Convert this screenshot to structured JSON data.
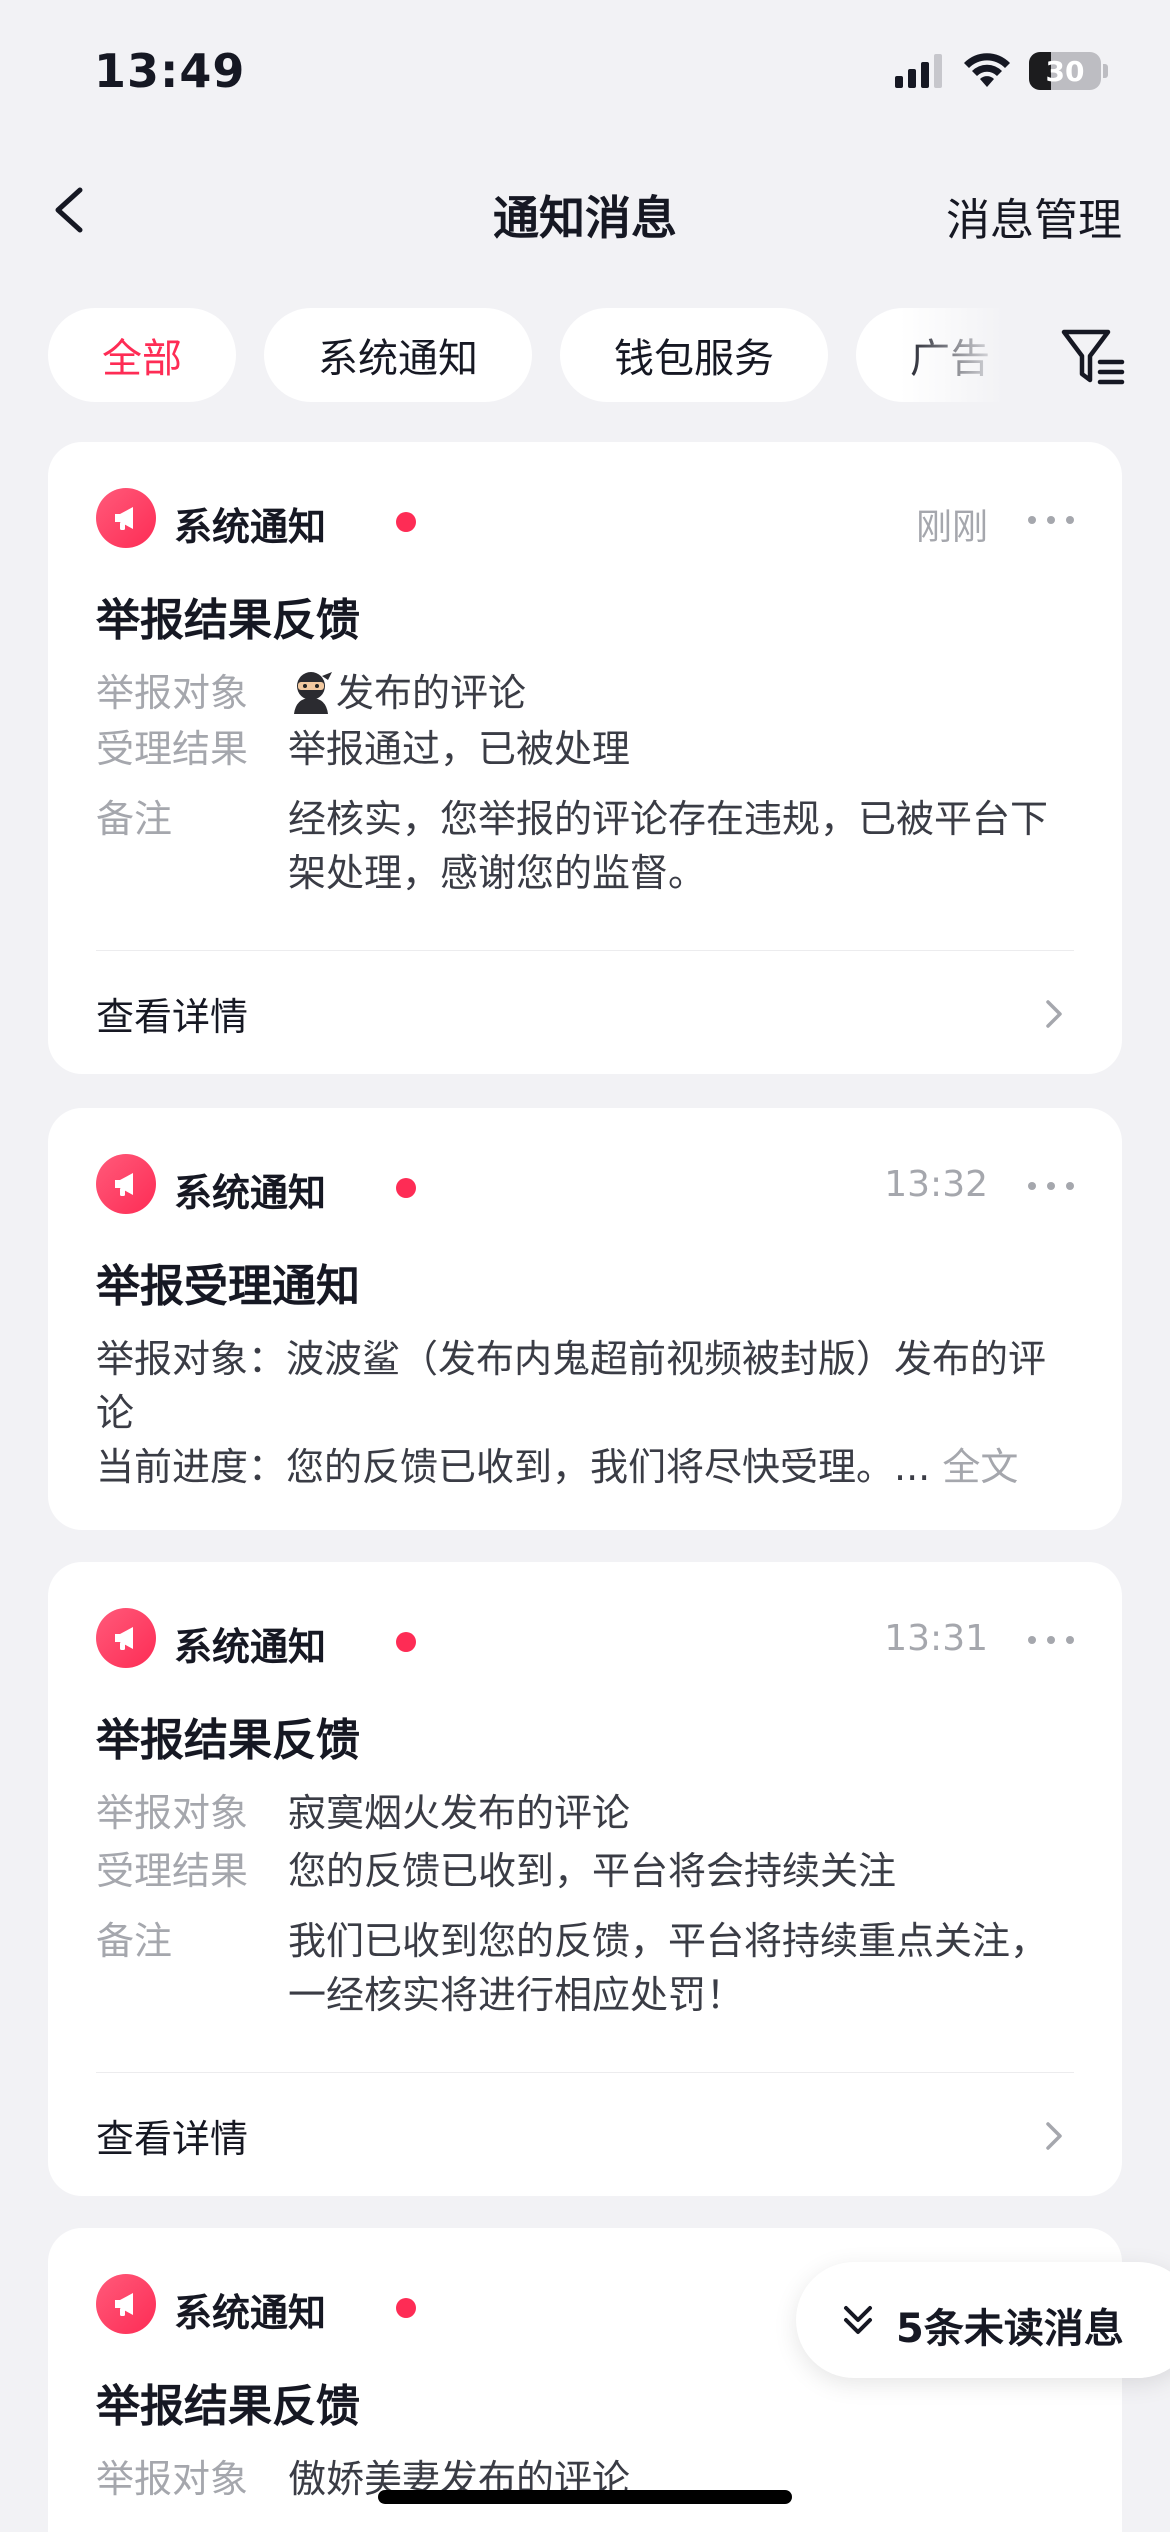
{
  "status_bar": {
    "time": "13:49",
    "battery": "30"
  },
  "header": {
    "title": "通知消息",
    "action_label": "消息管理"
  },
  "tabs": [
    {
      "label": "全部",
      "active": true
    },
    {
      "label": "系统通知",
      "active": false
    },
    {
      "label": "钱包服务",
      "active": false
    },
    {
      "label": "广告",
      "active": false
    }
  ],
  "cards": [
    {
      "source": "系统通知",
      "time": "刚刚",
      "title": "举报结果反馈",
      "rows": [
        {
          "key": "举报对象",
          "value": "发布的评论"
        },
        {
          "key": "受理结果",
          "value": "举报通过，已被处理"
        },
        {
          "key": "备注",
          "value_line1": "经核实，您举报的评论存在违规，已被平台下",
          "value_line2": "架处理，感谢您的监督。"
        }
      ],
      "detail_label": "查看详情"
    },
    {
      "source": "系统通知",
      "time": "13:32",
      "title": "举报受理通知",
      "line1": "举报对象：波波鲨（发布内鬼超前视频被封版）发布的评",
      "line2": "论",
      "line3": "当前进度：您的反馈已收到，我们将尽快受理。...",
      "fulltext": "全文"
    },
    {
      "source": "系统通知",
      "time": "13:31",
      "title": "举报结果反馈",
      "rows": [
        {
          "key": "举报对象",
          "value": "寂寞烟火发布的评论"
        },
        {
          "key": "受理结果",
          "value": "您的反馈已收到，平台将会持续关注"
        },
        {
          "key": "备注",
          "value_line1": "我们已收到您的反馈，平台将持续重点关注，",
          "value_line2": "一经核实将进行相应处罚！"
        }
      ],
      "detail_label": "查看详情"
    },
    {
      "source": "系统通知",
      "title": "举报结果反馈",
      "rows": [
        {
          "key": "举报对象",
          "value": "傲娇美妻发布的评论"
        }
      ]
    }
  ],
  "unread_pill": {
    "label": "5条未读消息"
  },
  "colors": {
    "accent": "#fe2c55",
    "background": "#f2f2f5",
    "muted": "#a5a7ad"
  }
}
